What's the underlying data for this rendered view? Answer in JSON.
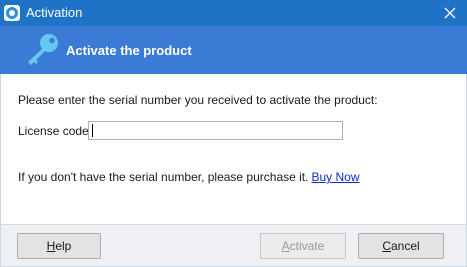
{
  "window": {
    "title": "Activation",
    "icons": {
      "app": "app-logo-icon",
      "close": "close-icon"
    }
  },
  "header": {
    "title": "Activate the product",
    "icon": "key-icon",
    "background_color": "#3a7bd5"
  },
  "content": {
    "prompt": "Please enter the serial number you received to activate the product:",
    "license_label": "License code:",
    "license_value": "",
    "purchase_text": "If you don't have the serial number, please purchase it.",
    "buy_link": "Buy Now"
  },
  "buttons": {
    "help": "Help",
    "activate": "Activate",
    "activate_enabled": false,
    "cancel": "Cancel"
  },
  "colors": {
    "titlebar": "#1f73c6",
    "header": "#3a7bd5",
    "link": "#0a2dd6",
    "footer": "#eef0f3"
  }
}
